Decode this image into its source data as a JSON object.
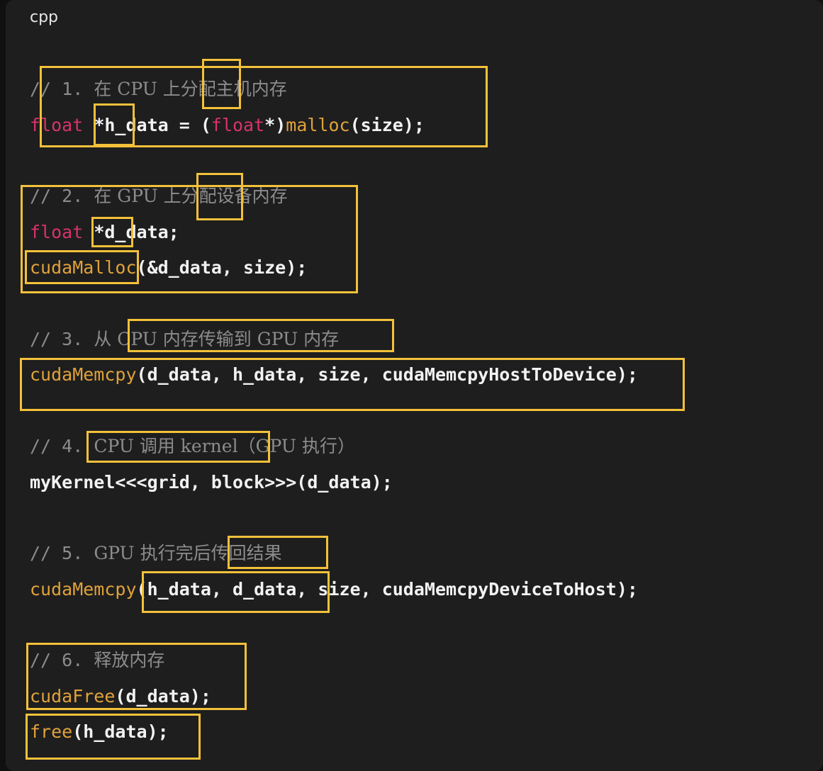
{
  "language_label": "cpp",
  "accent_box_color": "#f3c13a",
  "code": {
    "l1": {
      "a": "// 1. ",
      "b": "在 CPU 上分配主机内存"
    },
    "l2": {
      "kw": "float",
      "a": " *h_data = (",
      "kw2": "float",
      "b": "*)",
      "fn": "malloc",
      "c": "(size);"
    },
    "l3": {
      "a": "// 2. ",
      "b": "在 GPU 上分配设备内存"
    },
    "l4": {
      "kw": "float",
      "a": " *d_data;"
    },
    "l5": {
      "fn": "cudaMalloc",
      "a": "(&d_data, size);"
    },
    "l6": {
      "a": "// 3. ",
      "b": "从 CPU 内存传输到 GPU 内存"
    },
    "l7": {
      "fn": "cudaMemcpy",
      "a": "(d_data, h_data, size, cudaMemcpyHostToDevice);"
    },
    "l8": {
      "a": "// 4. ",
      "b": "CPU 调用 kernel（GPU 执行）"
    },
    "l9": {
      "a": "myKernel<<<grid, block>>>(d_data);"
    },
    "l10": {
      "a": "// 5. ",
      "b": "GPU 执行完后传回结果"
    },
    "l11": {
      "fn": "cudaMemcpy",
      "a": "(h_data, d_data, size, cudaMemcpyDeviceToHost);"
    },
    "l12": {
      "a": "// 6. ",
      "b": "释放内存"
    },
    "l13": {
      "fn": "cudaFree",
      "a": "(d_data);"
    },
    "l14": {
      "fn": "free",
      "a": "(h_data);"
    }
  }
}
